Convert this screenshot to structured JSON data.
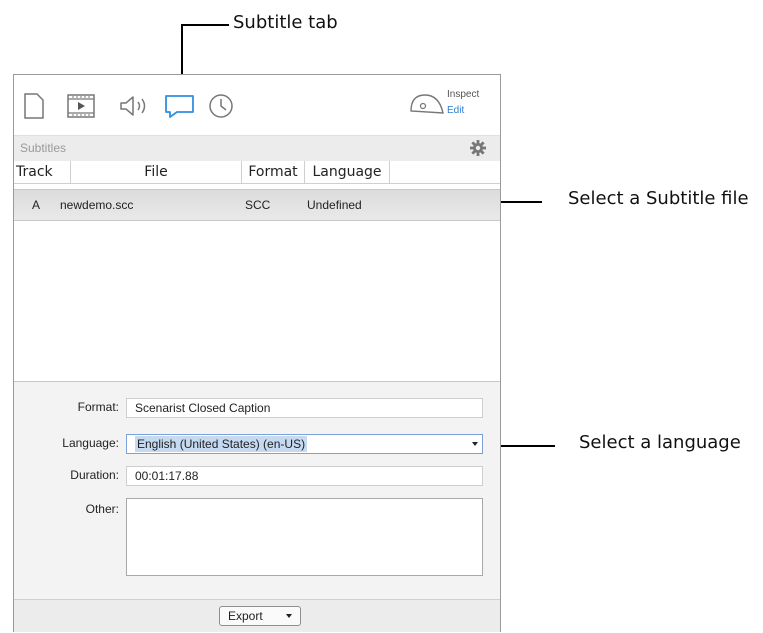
{
  "callouts": {
    "subtitle_tab": "Subtitle tab",
    "select_file": "Select a Subtitle file",
    "select_language": "Select a language"
  },
  "toolbar": {
    "icons": [
      "document-icon",
      "video-icon",
      "audio-icon",
      "subtitle-icon",
      "clock-icon"
    ],
    "inspect_label": "Inspect",
    "edit_label": "Edit",
    "accent": "#2f7fd2"
  },
  "section": {
    "title": "Subtitles"
  },
  "table": {
    "headers": [
      "Track",
      "File",
      "Format",
      "Language"
    ],
    "rows": [
      {
        "track": "A",
        "file": "newdemo.scc",
        "format": "SCC",
        "language": "Undefined"
      }
    ]
  },
  "details": {
    "format_label": "Format:",
    "format_value": "Scenarist Closed Caption",
    "language_label": "Language:",
    "language_value": "English (United States) (en-US)",
    "duration_label": "Duration:",
    "duration_value": "00:01:17.88",
    "other_label": "Other:",
    "other_value": ""
  },
  "footer": {
    "export_label": "Export"
  }
}
